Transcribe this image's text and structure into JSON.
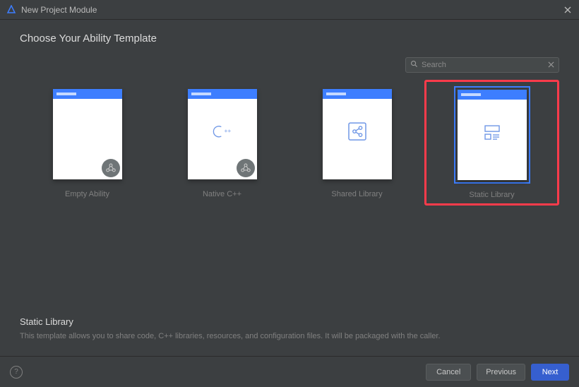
{
  "window": {
    "title": "New Project Module"
  },
  "heading": "Choose Your Ability Template",
  "search": {
    "placeholder": "Search",
    "value": ""
  },
  "templates": [
    {
      "label": "Empty Ability",
      "icon": "none",
      "corner": true,
      "selected": false
    },
    {
      "label": "Native C++",
      "icon": "cpp",
      "corner": true,
      "selected": false
    },
    {
      "label": "Shared Library",
      "icon": "share",
      "corner": false,
      "selected": false
    },
    {
      "label": "Static Library",
      "icon": "layout",
      "corner": false,
      "selected": true
    }
  ],
  "highlight_index": 3,
  "description": {
    "title": "Static Library",
    "text": "This template allows you to share code, C++ libraries, resources, and configuration files. It will be packaged with the caller."
  },
  "footer": {
    "cancel": "Cancel",
    "previous": "Previous",
    "next": "Next"
  }
}
